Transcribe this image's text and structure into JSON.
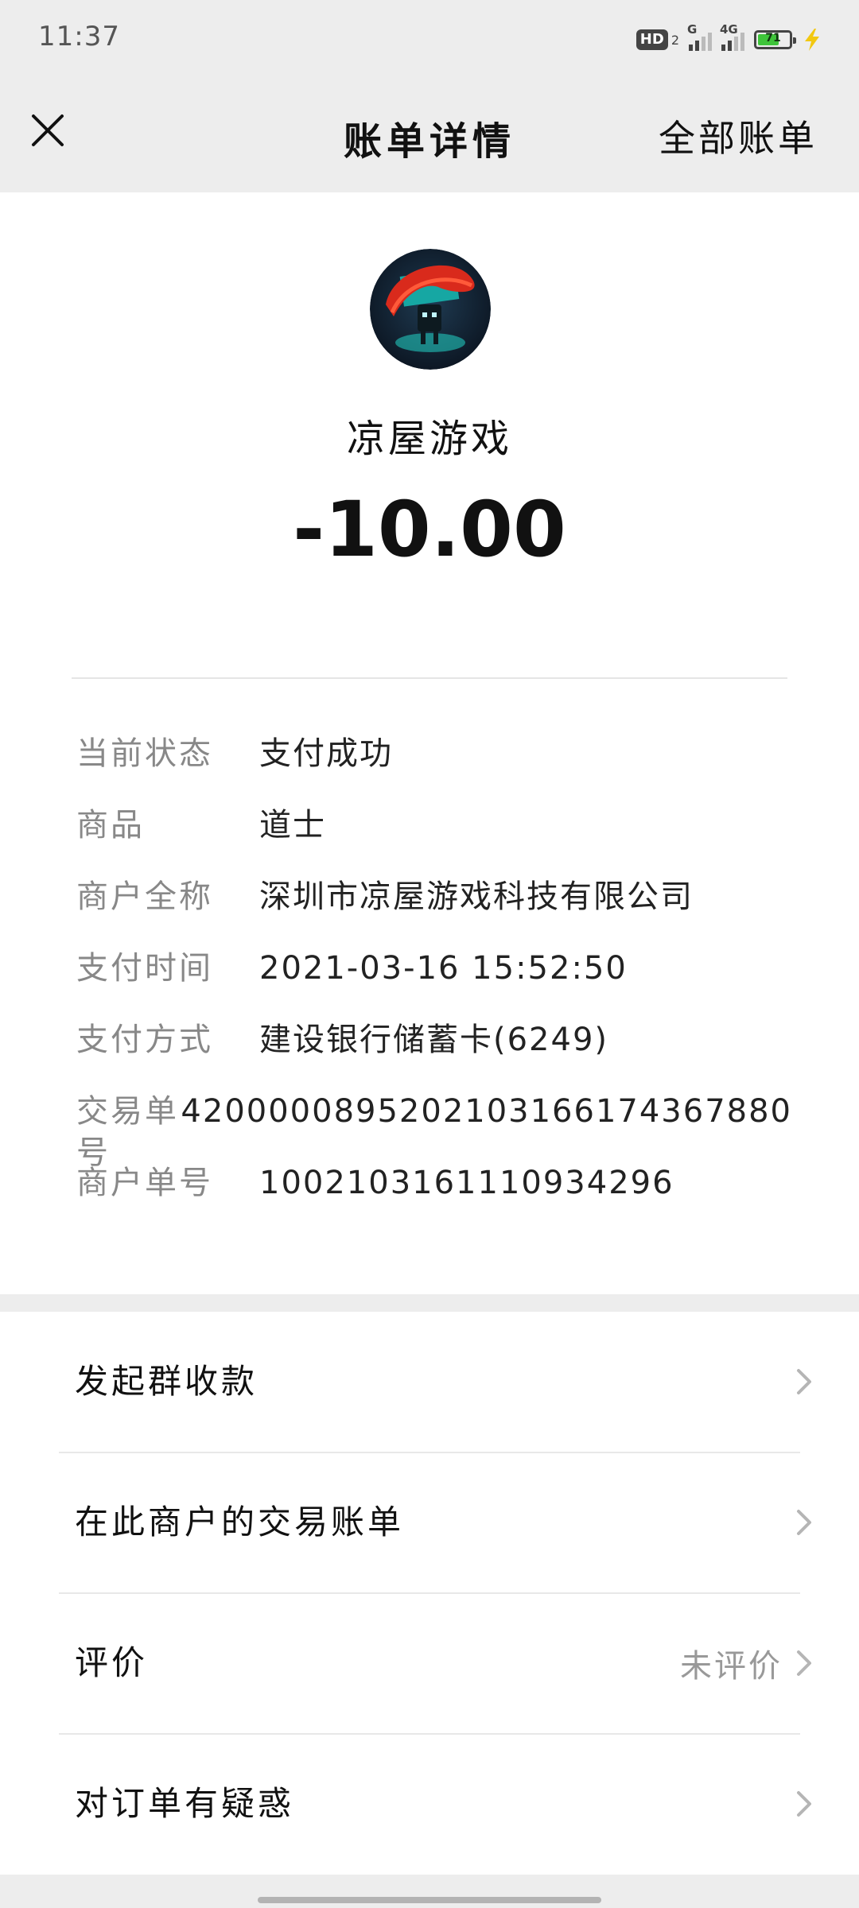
{
  "status_bar": {
    "time": "11:37",
    "hd_label": "HD",
    "hd_sub": "2",
    "sim1_label": "G",
    "sim2_label": "4G",
    "battery_level": "71",
    "battery_color": "#3ec43a",
    "charge_icon": "lightning-bolt"
  },
  "nav": {
    "title": "账单详情",
    "right_link": "全部账单",
    "close_icon": "close-x"
  },
  "detail": {
    "merchant": "凉屋游戏",
    "amount": "-10.00",
    "rows": [
      {
        "label": "当前状态",
        "value": "支付成功"
      },
      {
        "label": "商品",
        "value": "道士"
      },
      {
        "label": "商户全称",
        "value": "深圳市凉屋游戏科技有限公司"
      },
      {
        "label": "支付时间",
        "value": "2021-03-16 15:52:50"
      },
      {
        "label": "支付方式",
        "value": "建设银行储蓄卡(6249)"
      },
      {
        "label": "交易单号",
        "value": "4200000895202103166174367880"
      },
      {
        "label": "商户单号",
        "value": "1002103161110934296"
      }
    ]
  },
  "menu": [
    {
      "label": "发起群收款",
      "status": ""
    },
    {
      "label": "在此商户的交易账单",
      "status": ""
    },
    {
      "label": "评价",
      "status": "未评价"
    },
    {
      "label": "对订单有疑惑",
      "status": ""
    }
  ]
}
